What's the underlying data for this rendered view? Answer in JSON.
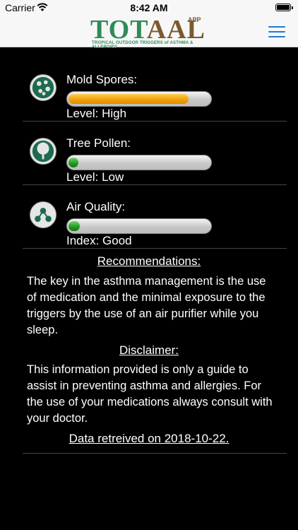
{
  "status_bar": {
    "carrier": "Carrier",
    "time": "8:42 AM"
  },
  "header": {
    "logo_word_a": "TOT",
    "logo_word_b": "AAL",
    "logo_app": "APP",
    "logo_tagline": "TROPICAL OUTDOOR TRIGGERS of ASTHMA & ALLERGIES"
  },
  "metrics": [
    {
      "label": "Mold Spores:",
      "level": "Level: High",
      "fraction": 0.86,
      "color": "#f0a000"
    },
    {
      "label": "Tree Pollen:",
      "level": "Level: Low",
      "fraction": 0.06,
      "color": "#1f9a1f"
    },
    {
      "label": "Air Quality:",
      "level": "Index: Good",
      "fraction": 0.08,
      "color": "#1f9a1f"
    }
  ],
  "recommendations": {
    "title": "Recommendations:",
    "text": "The key in the asthma management is the use of medication and the minimal exposure to the triggers by the use of an air purifier while you sleep."
  },
  "disclaimer": {
    "title": "Disclaimer:",
    "text": "This information provided is only a guide to assist in preventing asthma and allergies. For the use of your medications always consult with your doctor."
  },
  "retrieved": "Data retreived on 2018-10-22."
}
